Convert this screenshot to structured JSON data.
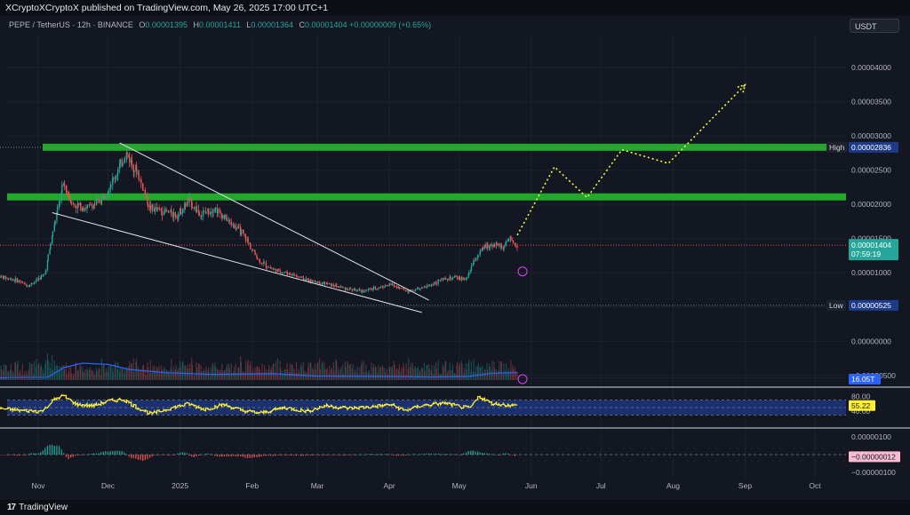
{
  "header": {
    "published": "XCryptoXCryptoX published on TradingView.com, May 26, 2025 17:00 UTC+1"
  },
  "symbol": {
    "name": "PEPE / TetherUS · 12h · BINANCE",
    "open_label": "O",
    "open": "0.00001395",
    "high_label": "H",
    "high": "0.00001411",
    "low_label": "L",
    "low": "0.00001364",
    "close_label": "C",
    "close": "0.00001404",
    "change": "+0.00000009 (+0.65%)"
  },
  "currency_button": {
    "label": "USDT"
  },
  "colors": {
    "background": "#131722",
    "bull": "#26a69a",
    "bear": "#ef5350",
    "zone": "#22a82b",
    "projection": "#f5f542",
    "rsi": "#fff130",
    "volume_ma": "#2962ff",
    "price_tag": "#26a69a",
    "info_tag": "#1e3a8a"
  },
  "footer": {
    "brand": "TradingView",
    "logo_icon": "tradingview-logo-icon"
  },
  "chart_data": {
    "type": "candlestick",
    "x_axis": {
      "ticks": [
        {
          "label": "Nov",
          "date": "2024-11-01"
        },
        {
          "label": "Dec",
          "date": "2024-12-01"
        },
        {
          "label": "2025",
          "date": "2025-01-01"
        },
        {
          "label": "Feb",
          "date": "2025-02-01"
        },
        {
          "label": "Mar",
          "date": "2025-03-01"
        },
        {
          "label": "Apr",
          "date": "2025-04-01"
        },
        {
          "label": "May",
          "date": "2025-05-01"
        },
        {
          "label": "Jun",
          "date": "2025-06-01"
        },
        {
          "label": "Jul",
          "date": "2025-07-01"
        },
        {
          "label": "Aug",
          "date": "2025-08-01"
        },
        {
          "label": "Sep",
          "date": "2025-09-01"
        },
        {
          "label": "Oct",
          "date": "2025-10-01"
        }
      ]
    },
    "y_axis": {
      "ticks": [
        "0.00004000",
        "0.00003500",
        "0.00003000",
        "0.00002500",
        "0.00002000",
        "0.00001500",
        "0.00001000",
        "0.00000500",
        "0.00000000",
        "−0.00000500"
      ],
      "tick_values": [
        4e-05,
        3.5e-05,
        3e-05,
        2.5e-05,
        2e-05,
        1.5e-05,
        1e-05,
        5e-06,
        0,
        -5e-06
      ],
      "range": [
        -6.2e-06,
        4.47e-05
      ]
    },
    "price_path": [
      [
        "2024-10-15",
        9.5e-06
      ],
      [
        "2024-10-22",
        9e-06
      ],
      [
        "2024-10-28",
        8.1e-06
      ],
      [
        "2024-11-04",
        9.8e-06
      ],
      [
        "2024-11-08",
        1.7e-05
      ],
      [
        "2024-11-12",
        2.3e-05
      ],
      [
        "2024-11-16",
        2e-05
      ],
      [
        "2024-11-22",
        1.95e-05
      ],
      [
        "2024-11-28",
        2.05e-05
      ],
      [
        "2024-12-04",
        2.4e-05
      ],
      [
        "2024-12-09",
        2.75e-05
      ],
      [
        "2024-12-14",
        2.45e-05
      ],
      [
        "2024-12-19",
        1.95e-05
      ],
      [
        "2024-12-25",
        1.9e-05
      ],
      [
        "2024-12-31",
        1.85e-05
      ],
      [
        "2025-01-05",
        2.05e-05
      ],
      [
        "2025-01-10",
        1.85e-05
      ],
      [
        "2025-01-16",
        1.95e-05
      ],
      [
        "2025-01-22",
        1.75e-05
      ],
      [
        "2025-01-28",
        1.58e-05
      ],
      [
        "2025-02-04",
        1.18e-05
      ],
      [
        "2025-02-10",
        1.05e-05
      ],
      [
        "2025-02-18",
        9.8e-06
      ],
      [
        "2025-02-26",
        8.8e-06
      ],
      [
        "2025-03-05",
        8.4e-06
      ],
      [
        "2025-03-12",
        7.8e-06
      ],
      [
        "2025-03-20",
        7.3e-06
      ],
      [
        "2025-03-27",
        7.8e-06
      ],
      [
        "2025-04-02",
        8.3e-06
      ],
      [
        "2025-04-09",
        7.3e-06
      ],
      [
        "2025-04-16",
        7.8e-06
      ],
      [
        "2025-04-23",
        8.9e-06
      ],
      [
        "2025-04-30",
        9.3e-06
      ],
      [
        "2025-05-04",
        9e-06
      ],
      [
        "2025-05-08",
        1.2e-05
      ],
      [
        "2025-05-12",
        1.38e-05
      ],
      [
        "2025-05-16",
        1.42e-05
      ],
      [
        "2025-05-20",
        1.38e-05
      ],
      [
        "2025-05-23",
        1.48e-05
      ],
      [
        "2025-05-26",
        1.4e-05
      ]
    ],
    "resistance_zones": [
      2.836e-05,
      2.11e-05
    ],
    "dotted_high_level": 2.836e-05,
    "dotted_low_level": 5.25e-06,
    "wedge": {
      "upper": [
        [
          "2024-12-06",
          2.9e-05
        ],
        [
          "2025-04-18",
          6e-06
        ]
      ],
      "lower": [
        [
          "2024-11-07",
          1.88e-05
        ],
        [
          "2025-04-15",
          4.2e-06
        ]
      ]
    },
    "projection": [
      [
        "2025-05-26",
        1.55e-05
      ],
      [
        "2025-06-11",
        2.55e-05
      ],
      [
        "2025-06-25",
        2.1e-05
      ],
      [
        "2025-07-10",
        2.8e-05
      ],
      [
        "2025-07-30",
        2.6e-05
      ],
      [
        "2025-09-01",
        3.75e-05
      ]
    ],
    "price_tags": [
      {
        "label": "High",
        "value_text": "0.00002836",
        "value": 2.836e-05
      },
      {
        "label": "",
        "value_text": "0.00001404",
        "value": 1.404e-05,
        "sub": "07:59:19"
      },
      {
        "label": "Low",
        "value_text": "0.00000525",
        "value": 5.25e-06
      }
    ],
    "volume": {
      "ma_tag": "16.05T",
      "ma_path": [
        [
          "2024-10-15",
          0.12
        ],
        [
          "2024-11-05",
          0.15
        ],
        [
          "2024-11-12",
          0.7
        ],
        [
          "2024-11-20",
          0.95
        ],
        [
          "2024-12-01",
          0.88
        ],
        [
          "2024-12-10",
          0.6
        ],
        [
          "2024-12-25",
          0.42
        ],
        [
          "2025-01-15",
          0.32
        ],
        [
          "2025-02-10",
          0.36
        ],
        [
          "2025-03-01",
          0.22
        ],
        [
          "2025-04-01",
          0.2
        ],
        [
          "2025-04-20",
          0.17
        ],
        [
          "2025-05-05",
          0.2
        ],
        [
          "2025-05-15",
          0.38
        ],
        [
          "2025-05-26",
          0.42
        ]
      ]
    },
    "rsi": {
      "ticks": [
        "80.00",
        "40.00"
      ],
      "tick_values": [
        80,
        40
      ],
      "value_text": "55.22",
      "value": 55.22,
      "band": [
        30,
        70
      ],
      "path": [
        [
          "2024-10-15",
          48
        ],
        [
          "2024-10-25",
          42
        ],
        [
          "2024-11-03",
          40
        ],
        [
          "2024-11-08",
          70
        ],
        [
          "2024-11-12",
          82
        ],
        [
          "2024-11-18",
          58
        ],
        [
          "2024-11-25",
          55
        ],
        [
          "2024-12-02",
          68
        ],
        [
          "2024-12-08",
          72
        ],
        [
          "2024-12-14",
          50
        ],
        [
          "2024-12-20",
          33
        ],
        [
          "2024-12-28",
          48
        ],
        [
          "2025-01-05",
          60
        ],
        [
          "2025-01-12",
          45
        ],
        [
          "2025-01-20",
          58
        ],
        [
          "2025-01-28",
          42
        ],
        [
          "2025-02-05",
          35
        ],
        [
          "2025-02-15",
          50
        ],
        [
          "2025-02-25",
          40
        ],
        [
          "2025-03-05",
          55
        ],
        [
          "2025-03-15",
          48
        ],
        [
          "2025-03-25",
          52
        ],
        [
          "2025-04-02",
          58
        ],
        [
          "2025-04-08",
          42
        ],
        [
          "2025-04-15",
          55
        ],
        [
          "2025-04-25",
          62
        ],
        [
          "2025-05-02",
          52
        ],
        [
          "2025-05-06",
          48
        ],
        [
          "2025-05-10",
          80
        ],
        [
          "2025-05-15",
          62
        ],
        [
          "2025-05-20",
          58
        ],
        [
          "2025-05-26",
          55
        ]
      ]
    },
    "macd": {
      "ticks": [
        "0.00000100",
        "−0.00000100"
      ],
      "tick_values": [
        1e-06,
        -1e-06
      ],
      "value_text": "−0.00000012",
      "value": -1.2e-07
    }
  }
}
